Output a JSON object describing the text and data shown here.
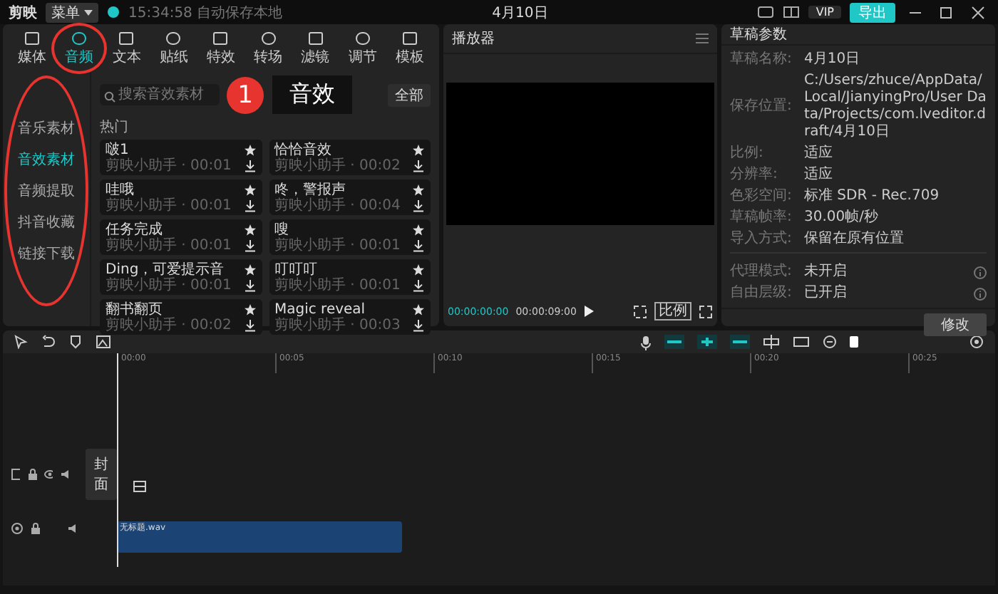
{
  "titlebar": {
    "app_name": "剪映",
    "menu": "菜单",
    "autosave": "15:34:58 自动保存本地",
    "project": "4月10日",
    "vip": "VIP",
    "export": "导出"
  },
  "tabs": [
    {
      "label": "媒体",
      "selected": false,
      "circled": false
    },
    {
      "label": "音频",
      "selected": true,
      "circled": true
    },
    {
      "label": "文本",
      "selected": false,
      "circled": false
    },
    {
      "label": "贴纸",
      "selected": false,
      "circled": false
    },
    {
      "label": "特效",
      "selected": false,
      "circled": false
    },
    {
      "label": "转场",
      "selected": false,
      "circled": false
    },
    {
      "label": "滤镜",
      "selected": false,
      "circled": false
    },
    {
      "label": "调节",
      "selected": false,
      "circled": false
    },
    {
      "label": "模板",
      "selected": false,
      "circled": false
    }
  ],
  "sidebar": [
    {
      "label": "音乐素材",
      "selected": false
    },
    {
      "label": "音效素材",
      "selected": true
    },
    {
      "label": "音频提取",
      "selected": false
    },
    {
      "label": "抖音收藏",
      "selected": false
    },
    {
      "label": "链接下载",
      "selected": false
    }
  ],
  "sidebar_circled": true,
  "search": {
    "placeholder": "搜索音效素材",
    "filter": "全部"
  },
  "section": "热门",
  "sounds": [
    {
      "title": "啵1",
      "meta": "剪映小助手 · 00:01"
    },
    {
      "title": "恰恰音效",
      "meta": "剪映小助手 · 00:02"
    },
    {
      "title": "哇哦",
      "meta": "剪映小助手 · 00:01"
    },
    {
      "title": "咚，警报声",
      "meta": "剪映小助手 · 00:04"
    },
    {
      "title": "任务完成",
      "meta": "剪映小助手 · 00:01"
    },
    {
      "title": "嗖",
      "meta": "剪映小助手 · 00:01"
    },
    {
      "title": "Ding，可爱提示音",
      "meta": "剪映小助手 · 00:01"
    },
    {
      "title": "叮叮叮",
      "meta": "剪映小助手 · 00:01"
    },
    {
      "title": "翻书翻页",
      "meta": "剪映小助手 · 00:02"
    },
    {
      "title": "Magic reveal",
      "meta": "剪映小助手 · 00:03"
    }
  ],
  "annotation": {
    "number": "1",
    "label": "音效"
  },
  "player": {
    "title": "播放器",
    "current": "00:00:00:00",
    "total": "00:00:09:00",
    "ratio": "比例"
  },
  "draft": {
    "title": "草稿参数",
    "rows": [
      {
        "label": "草稿名称:",
        "value": "4月10日"
      },
      {
        "label": "保存位置:",
        "value": "C:/Users/zhuce/AppData/Local/JianyingPro/User Data/Projects/com.lveditor.draft/4月10日"
      },
      {
        "label": "比例:",
        "value": "适应"
      },
      {
        "label": "分辨率:",
        "value": "适应"
      },
      {
        "label": "色彩空间:",
        "value": "标准 SDR - Rec.709"
      },
      {
        "label": "草稿帧率:",
        "value": "30.00帧/秒"
      },
      {
        "label": "导入方式:",
        "value": "保留在原有位置"
      }
    ],
    "toggles": [
      {
        "label": "代理模式:",
        "value": "未开启"
      },
      {
        "label": "自由层级:",
        "value": "已开启"
      }
    ],
    "edit": "修改"
  },
  "timeline": {
    "ticks": [
      "00:00",
      "00:05",
      "00:10",
      "00:15",
      "00:20",
      "00:25"
    ],
    "cover": "封面",
    "clip": "无标题.wav"
  }
}
